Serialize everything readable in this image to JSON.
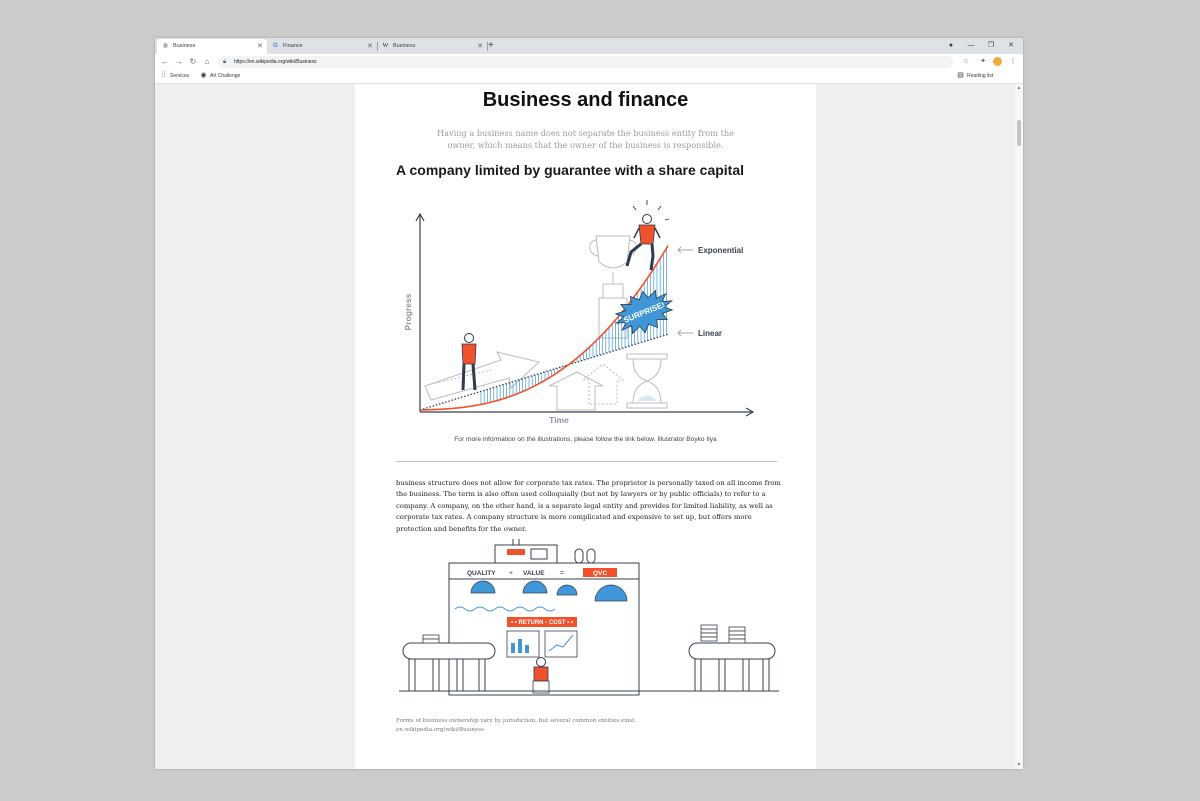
{
  "browser": {
    "tabs": [
      {
        "label": "Business",
        "favicon": "globe-icon",
        "active": true
      },
      {
        "label": "Finance",
        "favicon": "google-g-icon",
        "active": false
      },
      {
        "label": "Business",
        "favicon": "wikipedia-w-icon",
        "active": false
      }
    ],
    "url": "https://en.wikipedia.org/wiki/Business",
    "bookmarks": [
      {
        "label": "Services",
        "icon": "apps-grid-icon"
      },
      {
        "label": "Art Challenge",
        "icon": "globe-icon"
      }
    ],
    "reading_list": "Reading list"
  },
  "article": {
    "title": "Business and finance",
    "lead": "Having a business name does not separate the business entity from the owner, which means that the owner of the business is responsible.",
    "section_heading": "A company limited by guarantee with a share capital",
    "illustration1": {
      "y_axis_label": "Progress",
      "x_axis_label": "Time",
      "exponential_label": "Exponential",
      "linear_label": "Linear",
      "badge_text": "SURPRISE!"
    },
    "credit": "For more information on the illustrations, please follow the link below.  Illustrator Boyko Ilya",
    "paragraph": " business structure does not allow for corporate tax rates. The proprietor is personally taxed on all income from the business. The term is also often used colloquially (but not by lawyers or by public officials) to refer to a company. A company, on the other hand, is a separate legal entity and provides for limited liability, as well as corporate tax rates. A company structure is more complicated and expensive to set up, but offers more protection and benefits for the owner.",
    "illustration2": {
      "quality": "QUALITY",
      "plus": "+",
      "value": "VALUE",
      "equals": "=",
      "qvc": "QVC",
      "return_cost": "• • RETURN - COST • •"
    },
    "caption_line1": "Forms of business ownership vary by jurisdiction, but several common entities exist.",
    "caption_line2": "en.wikipedia.org/wiki/Business"
  },
  "colors": {
    "accent": "#f0532b",
    "line_blue": "#3f97d8",
    "ink": "#3a4150"
  }
}
